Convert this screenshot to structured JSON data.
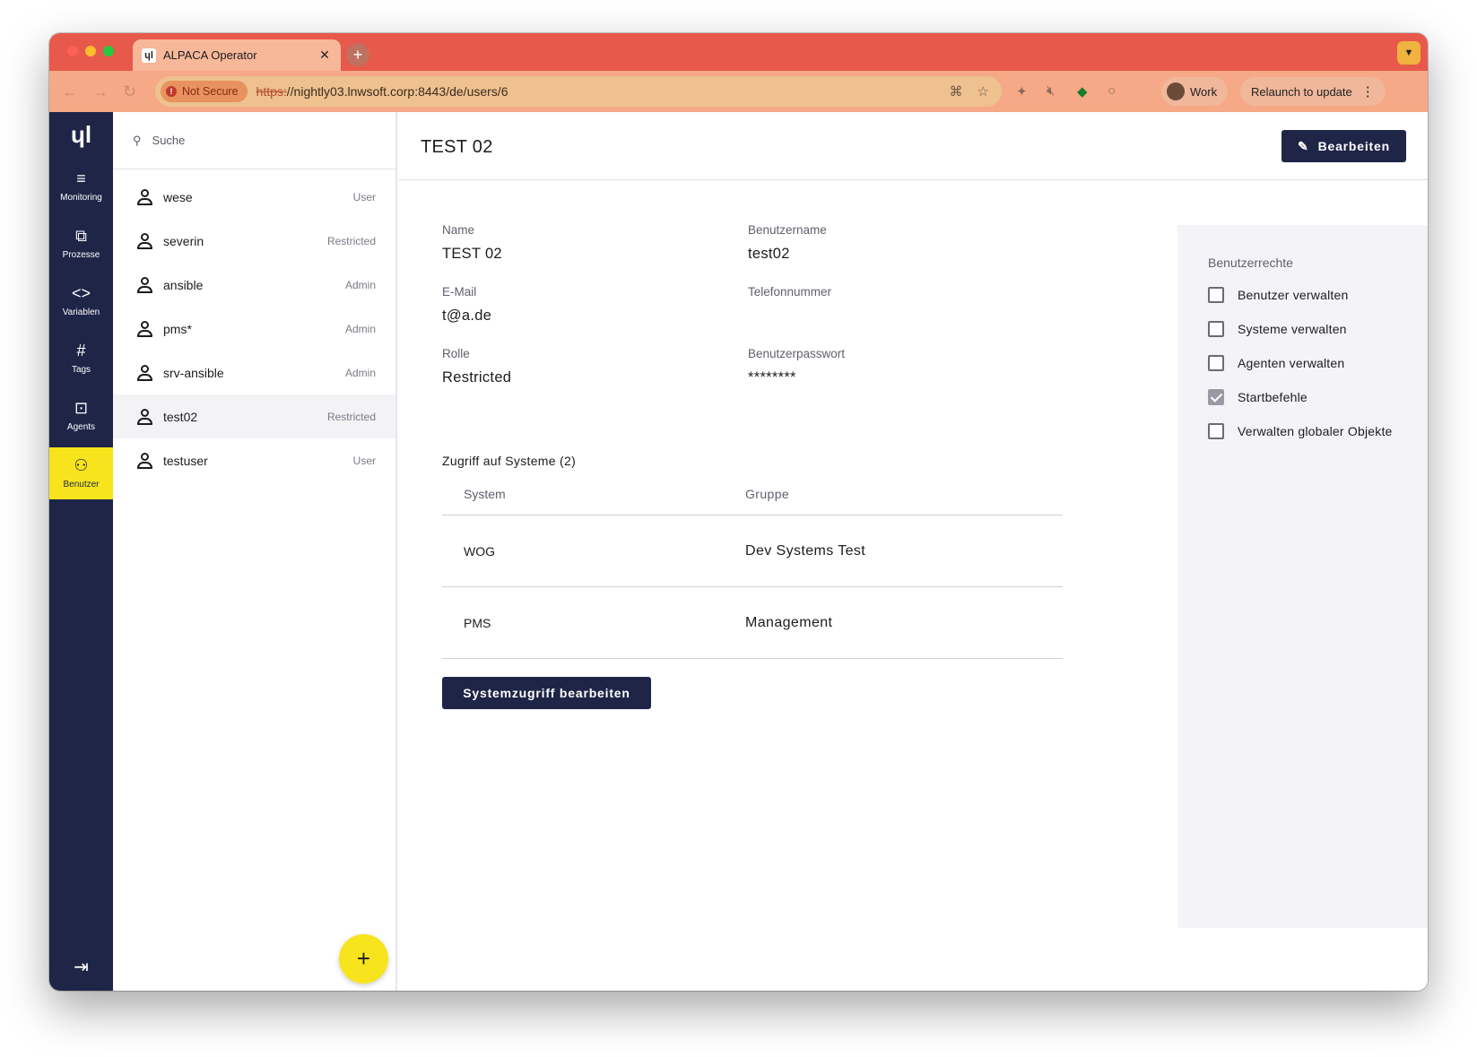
{
  "browser": {
    "tab_title": "ALPACA Operator",
    "tab_favicon": "ɥl",
    "security_label": "Not Secure",
    "url_scheme": "https:",
    "url_rest": "//nightly03.lnwsoft.corp:8443/de/users/6",
    "profile_name": "Work",
    "relaunch_label": "Relaunch to update",
    "icons": [
      "back-icon",
      "forward-icon",
      "reload-icon",
      "translate-icon",
      "bookmark-star-icon",
      "extension-icon",
      "mute-icon",
      "extension-green-icon"
    ]
  },
  "rail": {
    "logo": "ɥl",
    "items": [
      {
        "label": "Monitoring",
        "icon": "≡"
      },
      {
        "label": "Prozesse",
        "icon": "⧉"
      },
      {
        "label": "Variablen",
        "icon": "<>"
      },
      {
        "label": "Tags",
        "icon": "#"
      },
      {
        "label": "Agents",
        "icon": "⊡"
      },
      {
        "label": "Benutzer",
        "icon": "⚇"
      }
    ],
    "logout_icon": "⇥",
    "active": "Benutzer"
  },
  "list": {
    "search_placeholder": "Suche",
    "users": [
      {
        "name": "wese",
        "role": "User"
      },
      {
        "name": "severin",
        "role": "Restricted"
      },
      {
        "name": "ansible",
        "role": "Admin"
      },
      {
        "name": "pms*",
        "role": "Admin"
      },
      {
        "name": "srv-ansible",
        "role": "Admin"
      },
      {
        "name": "test02",
        "role": "Restricted"
      },
      {
        "name": "testuser",
        "role": "User"
      }
    ],
    "selected": "test02",
    "fab_label": "+"
  },
  "detail": {
    "title": "TEST 02",
    "edit_label": "Bearbeiten",
    "fields": {
      "name_label": "Name",
      "name_value": "TEST 02",
      "username_label": "Benutzername",
      "username_value": "test02",
      "email_label": "E-Mail",
      "email_value": "t@a.de",
      "phone_label": "Telefonnummer",
      "phone_value": "",
      "role_label": "Rolle",
      "role_value": "Restricted",
      "password_label": "Benutzerpasswort",
      "password_value": "********"
    },
    "systems_title": "Zugriff auf Systeme (2)",
    "systems_header": {
      "system": "System",
      "group": "Gruppe"
    },
    "systems": [
      {
        "system": "WOG",
        "group": "Dev Systems Test"
      },
      {
        "system": "PMS",
        "group": "Management"
      }
    ],
    "systems_edit_label": "Systemzugriff bearbeiten",
    "rights_title": "Benutzerrechte",
    "rights": [
      {
        "label": "Benutzer verwalten",
        "checked": false
      },
      {
        "label": "Systeme verwalten",
        "checked": false
      },
      {
        "label": "Agenten verwalten",
        "checked": false
      },
      {
        "label": "Startbefehle",
        "checked": true
      },
      {
        "label": "Verwalten globaler Objekte",
        "checked": false
      }
    ]
  },
  "colors": {
    "rail_bg": "#1f2547",
    "accent_yellow": "#f7e41c",
    "tabbar": "#e7594a",
    "toolbar": "#f6a986"
  }
}
